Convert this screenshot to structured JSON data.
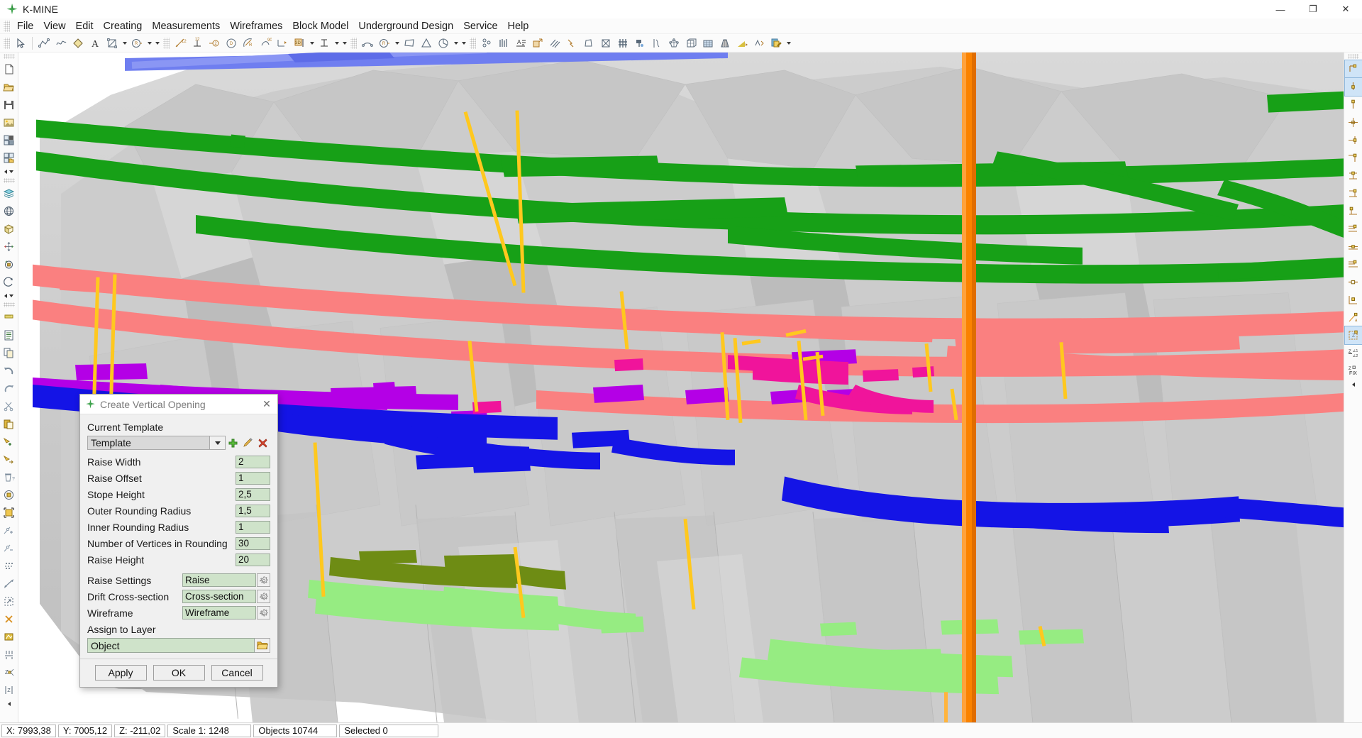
{
  "window": {
    "title": "K-MINE",
    "logo_icon": "kmine-star-icon",
    "controls": [
      {
        "name": "minimize-button",
        "glyph": "—"
      },
      {
        "name": "maximize-button",
        "glyph": "❐"
      },
      {
        "name": "close-button",
        "glyph": "✕"
      }
    ]
  },
  "menubar": {
    "items": [
      {
        "label": "File"
      },
      {
        "label": "View"
      },
      {
        "label": "Edit"
      },
      {
        "label": "Creating"
      },
      {
        "label": "Measurements"
      },
      {
        "label": "Wireframes"
      },
      {
        "label": "Block Model"
      },
      {
        "label": "Underground Design"
      },
      {
        "label": "Service"
      },
      {
        "label": "Help"
      }
    ]
  },
  "toolbar": {
    "groups": [
      {
        "buttons": [
          {
            "icon": "cursor-arrow-icon"
          }
        ]
      },
      {
        "buttons": [
          {
            "icon": "polyline-icon"
          },
          {
            "icon": "spline-icon"
          },
          {
            "icon": "polygon-fill-icon"
          },
          {
            "icon": "text-A-icon"
          },
          {
            "icon": "rectangle-nodes-icon",
            "dropdown": true
          },
          {
            "icon": "circle-radius-icon",
            "dropdown": true
          },
          {
            "icon": "extra-dropdown-icon",
            "dropdownonly": true
          }
        ]
      },
      {
        "buttons": [
          {
            "icon": "dim-linear-icon"
          },
          {
            "icon": "dim-baseline-icon"
          },
          {
            "icon": "dim-diameter-icon"
          },
          {
            "icon": "dim-arc-icon"
          },
          {
            "icon": "dim-radius-icon"
          },
          {
            "icon": "dim-angle90-icon"
          },
          {
            "icon": "dim-leader-icon"
          },
          {
            "icon": "dim-3d-icon",
            "dropdown": true
          },
          {
            "icon": "dim-ordinate-icon",
            "dropdown": true
          },
          {
            "icon": "extra-dropdown-icon",
            "dropdownonly": true
          }
        ]
      },
      {
        "buttons": [
          {
            "icon": "arc-icon"
          },
          {
            "icon": "circle-r-icon",
            "dropdown": true
          },
          {
            "icon": "quad-icon"
          },
          {
            "icon": "triangle-icon"
          },
          {
            "icon": "pie-icon",
            "dropdown": true
          },
          {
            "icon": "extra-dropdown-icon",
            "dropdownonly": true
          }
        ]
      },
      {
        "buttons": [
          {
            "icon": "points-icon"
          },
          {
            "icon": "bars-icon"
          },
          {
            "icon": "text-lines-icon"
          },
          {
            "icon": "export-box-icon"
          },
          {
            "icon": "hatch-icon"
          },
          {
            "icon": "lightning-icon"
          },
          {
            "icon": "prism-icon"
          },
          {
            "icon": "crossed-box-icon"
          },
          {
            "icon": "grid-hash-icon"
          },
          {
            "icon": "drill-icon"
          },
          {
            "icon": "contour-icon"
          },
          {
            "icon": "mesh-nodes-icon"
          },
          {
            "icon": "block-cube-icon"
          },
          {
            "icon": "table-icon"
          },
          {
            "icon": "tunnel-icon"
          },
          {
            "icon": "slope-icon"
          },
          {
            "icon": "vector-icon"
          },
          {
            "icon": "edit-file-icon"
          },
          {
            "icon": "extra-dropdown-icon",
            "dropdownonly": true
          }
        ]
      }
    ]
  },
  "left_toolbar": {
    "items": [
      {
        "icon": "grip-icon",
        "type": "grip"
      },
      {
        "icon": "new-file-icon"
      },
      {
        "icon": "open-folder-icon"
      },
      {
        "icon": "save-disk-icon"
      },
      {
        "icon": "import-image-icon"
      },
      {
        "icon": "save-selected-icon"
      },
      {
        "icon": "open-selected-icon"
      },
      {
        "icon": "more-arrows-icon",
        "type": "arrows"
      },
      {
        "icon": "grip-icon",
        "type": "grip"
      },
      {
        "icon": "layers-icon"
      },
      {
        "icon": "globe-icon"
      },
      {
        "icon": "cube-icon"
      },
      {
        "icon": "pan-move-icon"
      },
      {
        "icon": "rotate-object-icon"
      },
      {
        "icon": "orbit-icon"
      },
      {
        "icon": "more-arrows-icon",
        "type": "arrows"
      },
      {
        "icon": "grip-icon",
        "type": "grip"
      },
      {
        "icon": "ruler-icon"
      },
      {
        "icon": "list-icon"
      },
      {
        "icon": "copy-icon"
      },
      {
        "icon": "undo-icon"
      },
      {
        "icon": "redo-icon"
      },
      {
        "icon": "cut-scissors-icon"
      },
      {
        "icon": "paste-icon"
      },
      {
        "icon": "select-add-icon"
      },
      {
        "icon": "select-remove-icon"
      },
      {
        "icon": "delete-trash-icon"
      },
      {
        "icon": "rotate-selection-icon"
      },
      {
        "icon": "scale-selection-icon"
      },
      {
        "icon": "add-node-icon"
      },
      {
        "icon": "remove-node-icon"
      },
      {
        "icon": "dotted-points-icon"
      },
      {
        "icon": "stretch-icon"
      },
      {
        "icon": "marquee-icon"
      },
      {
        "icon": "delete-cross-icon"
      },
      {
        "icon": "fill-area-icon"
      },
      {
        "icon": "distribute-icon"
      },
      {
        "icon": "z-node-icon"
      },
      {
        "icon": "z-bracket-icon"
      },
      {
        "icon": "collapse-arrow-icon",
        "type": "collapse"
      }
    ]
  },
  "right_toolbar": {
    "items": [
      {
        "icon": "grip-icon",
        "type": "grip"
      },
      {
        "icon": "snap-endpoint-icon",
        "selected": true
      },
      {
        "icon": "snap-midpoint-icon",
        "selected": true
      },
      {
        "icon": "snap-node-icon"
      },
      {
        "icon": "snap-center-icon"
      },
      {
        "icon": "snap-insert-icon"
      },
      {
        "icon": "snap-quadrant-icon"
      },
      {
        "icon": "snap-perp-icon"
      },
      {
        "icon": "snap-corner-icon"
      },
      {
        "icon": "snap-tangent-icon"
      },
      {
        "icon": "snap-parallel-icon"
      },
      {
        "icon": "snap-extension-icon"
      },
      {
        "icon": "snap-intersect-icon"
      },
      {
        "icon": "snap-nearest-icon"
      },
      {
        "icon": "snap-apparent-icon"
      },
      {
        "icon": "snap-grid-icon"
      },
      {
        "icon": "snap-angle-icon"
      },
      {
        "icon": "snap-box-icon",
        "selected": true
      },
      {
        "icon": "snap-z-angle-icon"
      },
      {
        "icon": "snap-zfix-icon",
        "label": "FIX"
      },
      {
        "icon": "collapse-arrow-icon",
        "type": "collapse"
      }
    ]
  },
  "dialog": {
    "title": "Create Vertical Opening",
    "logo_icon": "kmine-star-icon",
    "close_glyph": "✕",
    "current_template_label": "Current Template",
    "template_value": "Template",
    "template_buttons": [
      {
        "name": "add-template-button",
        "icon": "plus-green-icon"
      },
      {
        "name": "edit-template-button",
        "icon": "pencil-icon"
      },
      {
        "name": "delete-template-button",
        "icon": "red-x-icon"
      }
    ],
    "fields": [
      {
        "label": "Raise Width",
        "value": "2",
        "name": "raise-width"
      },
      {
        "label": "Raise Offset",
        "value": "1",
        "name": "raise-offset"
      },
      {
        "label": "Stope Height",
        "value": "2,5",
        "name": "stope-height"
      },
      {
        "label": "Outer Rounding Radius",
        "value": "1,5",
        "name": "outer-rounding-radius"
      },
      {
        "label": "Inner Rounding Radius",
        "value": "1",
        "name": "inner-rounding-radius"
      },
      {
        "label": "Number of Vertices in Rounding",
        "value": "30",
        "name": "vertices-in-rounding"
      },
      {
        "label": "Raise Height",
        "value": "20",
        "name": "raise-height"
      }
    ],
    "settings_rows": [
      {
        "label": "Raise Settings",
        "value": "Raise",
        "name": "raise-settings"
      },
      {
        "label": "Drift Cross-section",
        "value": "Cross-section",
        "name": "drift-cross-section"
      },
      {
        "label": "Wireframe",
        "value": "Wireframe",
        "name": "wireframe"
      }
    ],
    "assign_layer_label": "Assign to Layer",
    "assign_layer_value": "Object",
    "buttons": [
      {
        "label": "Apply",
        "name": "apply-button"
      },
      {
        "label": "OK",
        "name": "ok-button"
      },
      {
        "label": "Cancel",
        "name": "cancel-button"
      }
    ]
  },
  "statusbar": {
    "cells": [
      {
        "text": "X: 7993,38",
        "name": "status-x"
      },
      {
        "text": "Y: 7005,12",
        "name": "status-y"
      },
      {
        "text": "Z: -211,02",
        "name": "status-z"
      },
      {
        "text": "Scale 1: 1248",
        "name": "status-scale"
      },
      {
        "text": "Objects 10744",
        "name": "status-objects"
      },
      {
        "text": "Selected 0",
        "name": "status-selected"
      }
    ]
  },
  "viewport": {
    "colors": {
      "terrain_light": "#d4d4d4",
      "terrain_mid": "#c2c2c2",
      "terrain_dark": "#aeaeae",
      "green_level": "#17a017",
      "blue_level": "#1414e6",
      "salmon_level": "#fa8080",
      "purple_level": "#b400e6",
      "magenta_level": "#f0149b",
      "lightblue_level": "#6f7ef0",
      "olive_level": "#6e8c14",
      "lightgreen_level": "#96ec82",
      "orange_shaft": "#fa8200",
      "yellow_raise": "#ffc81e",
      "background": "#ffffff"
    }
  }
}
